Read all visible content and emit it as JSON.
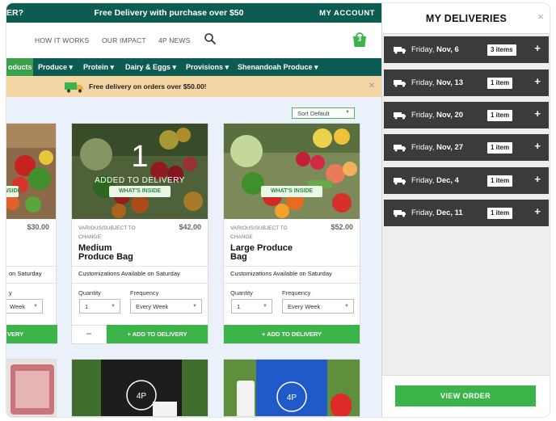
{
  "topbar": {
    "left_fragment": "ER?",
    "promo": "Free Delivery with purchase over $50",
    "account": "MY ACCOUNT"
  },
  "header": {
    "nav": [
      "HOW IT WORKS",
      "OUR IMPACT",
      "4P NEWS"
    ],
    "cart_count": "3"
  },
  "categories": {
    "active": "oducts",
    "items": [
      "Produce",
      "Protein",
      "Dairy & Eggs",
      "Provisions",
      "Shenandoah Produce"
    ]
  },
  "banner": {
    "text": "Free delivery on orders over $50.00!"
  },
  "sort": {
    "label": "Sort Default"
  },
  "products": [
    {
      "price": "$30.00",
      "whats_inside": "INSIDE",
      "customizations": "on Saturday",
      "frequency_label": "y",
      "frequency_value": "Week",
      "button": "VERY"
    },
    {
      "price": "$42.00",
      "subtag": "VARIOUS/SUBJECT TO CHANGE",
      "title_line1": "Medium",
      "title_line2": "Produce Bag",
      "customizations": "Customizations Available on Saturday",
      "quantity_label": "Quantity",
      "quantity_value": "1",
      "frequency_label": "Frequency",
      "frequency_value": "Every Week",
      "whats_inside": "WHAT'S INSIDE",
      "overlay_count": "1",
      "overlay_text": "ADDED TO DELIVERY",
      "minus": "−",
      "button": "+ ADD TO DELIVERY"
    },
    {
      "price": "$52.00",
      "subtag": "VARIOUS/SUBJECT TO CHANGE",
      "title_line1": "Large Produce",
      "title_line2": "Bag",
      "customizations": "Customizations Available on Saturday",
      "quantity_label": "Quantity",
      "quantity_value": "1",
      "frequency_label": "Frequency",
      "frequency_value": "Every Week",
      "whats_inside": "WHAT'S INSIDE",
      "button": "+ ADD TO DELIVERY"
    }
  ],
  "panel": {
    "title": "MY DELIVERIES",
    "close": "×",
    "deliveries": [
      {
        "weekday": "Friday, ",
        "date": "Nov, 6",
        "items": "3 items"
      },
      {
        "weekday": "Friday, ",
        "date": "Nov, 13",
        "items": "1 item"
      },
      {
        "weekday": "Friday, ",
        "date": "Nov, 20",
        "items": "1 item"
      },
      {
        "weekday": "Friday, ",
        "date": "Nov, 27",
        "items": "1 item"
      },
      {
        "weekday": "Friday, ",
        "date": "Dec, 4",
        "items": "1 item"
      },
      {
        "weekday": "Friday, ",
        "date": "Dec, 11",
        "items": "1 item"
      }
    ],
    "view_order": "VIEW ORDER"
  },
  "colors": {
    "brand_dark_green": "#0d5c52",
    "action_green": "#3bb54a",
    "banner_peach": "#f4d6a5",
    "delivery_row": "#3b3b3b"
  }
}
